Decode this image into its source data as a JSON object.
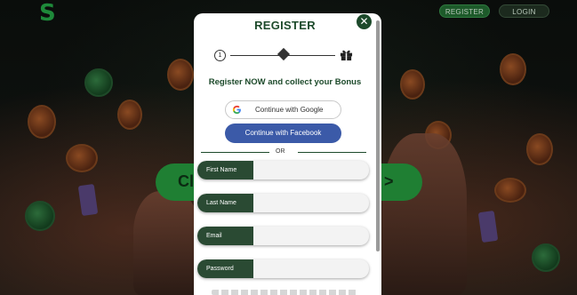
{
  "header": {
    "logo": "S",
    "register_label": "REGISTER",
    "login_label": "LOGIN"
  },
  "hero": {
    "cta_left": "Cl",
    "cta_right": ">"
  },
  "modal": {
    "title": "REGISTER",
    "close_icon": "close-icon",
    "step_number": "1",
    "subtitle": "Register NOW and collect your Bonus",
    "google_label": "Continue with Google",
    "facebook_label": "Continue with Facebook",
    "divider_text": "OR",
    "fields": [
      {
        "label": "First Name",
        "value": ""
      },
      {
        "label": "Last Name",
        "value": ""
      },
      {
        "label": "Email",
        "value": ""
      },
      {
        "label": "Password",
        "value": ""
      }
    ]
  },
  "colors": {
    "brand_green": "#1d4a2b",
    "facebook_blue": "#3b5aa8",
    "field_label_bg": "#2a4a33"
  }
}
